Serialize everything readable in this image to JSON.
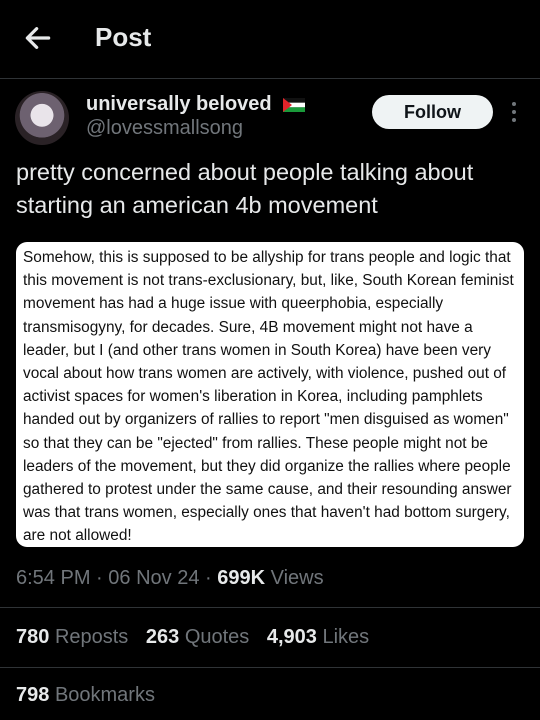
{
  "header": {
    "title": "Post"
  },
  "author": {
    "name": "universally beloved",
    "handle": "@lovessmallsong",
    "follow_label": "Follow"
  },
  "post": {
    "text": "pretty concerned about people talking about starting an american 4b movement"
  },
  "quote": {
    "text": "Somehow, this is supposed to be allyship for trans people and logic that this movement is not trans-exclusionary, but, like, South Korean feminist movement has had a huge issue with queerphobia, especially transmisogyny, for decades. Sure, 4B movement might not have a leader, but I (and other trans women in South Korea) have been very vocal about how trans women are actively, with violence, pushed out of activist spaces for women's liberation in Korea, including pamphlets handed out by organizers of rallies to report \"men disguised as women\" so that they can be \"ejected\" from rallies. These people might not be leaders of the movement, but they did organize the rallies where people gathered to protest under the same cause, and their resounding answer was that trans women, especially ones that haven't had bottom surgery, are not allowed!"
  },
  "meta": {
    "time": "6:54 PM",
    "date": "06 Nov 24",
    "views_count": "699K",
    "views_label": "Views",
    "separator": "·"
  },
  "stats": {
    "reposts_count": "780",
    "reposts_label": "Reposts",
    "quotes_count": "263",
    "quotes_label": "Quotes",
    "likes_count": "4,903",
    "likes_label": "Likes"
  },
  "bookmarks": {
    "count": "798",
    "label": "Bookmarks"
  },
  "icons": {
    "back": "arrow-left-icon",
    "more": "more-vertical-icon",
    "flag": "palestine-flag-icon"
  },
  "colors": {
    "background": "#000000",
    "text": "#e7e9ea",
    "muted": "#71767b",
    "divider": "#2f3336",
    "follow_bg": "#eff3f4"
  }
}
